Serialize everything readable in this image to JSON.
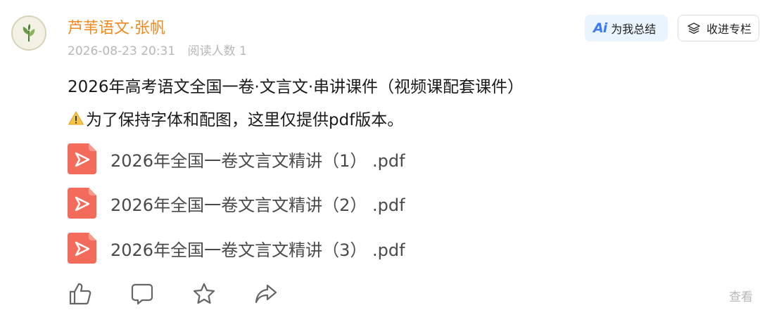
{
  "author": {
    "name": "芦苇语文·张帆",
    "avatar_icon": "leaf-sprout-icon"
  },
  "meta": {
    "date": "2026-08-23 20:31",
    "read_count": "阅读人数 1"
  },
  "header_buttons": {
    "ai_glyph": "Ai",
    "summary_label": "为我总结",
    "collect_label": "收进专栏"
  },
  "content": {
    "title": "2026年高考语文全国一卷·文言文·串讲课件（视频课配套课件）",
    "notice": "为了保持字体和配图，这里仅提供pdf版本。",
    "notice_icon": "warning-icon"
  },
  "files": [
    {
      "name": "2026年全国一卷文言文精讲（1） .pdf",
      "icon": "pdf-icon"
    },
    {
      "name": "2026年全国一卷文言文精讲（2） .pdf",
      "icon": "pdf-icon"
    },
    {
      "name": "2026年全国一卷文言文精讲（3） .pdf",
      "icon": "pdf-icon"
    }
  ],
  "actions": [
    "like-icon",
    "comment-icon",
    "star-icon",
    "share-icon"
  ],
  "footer": {
    "view_more": "查看"
  },
  "colors": {
    "author": "#ef8a1f",
    "meta": "#b7b7b7",
    "pdf": "#f26b5b",
    "ai_bg": "#eaf4ff",
    "ai_accent": "#3d7bf5"
  }
}
